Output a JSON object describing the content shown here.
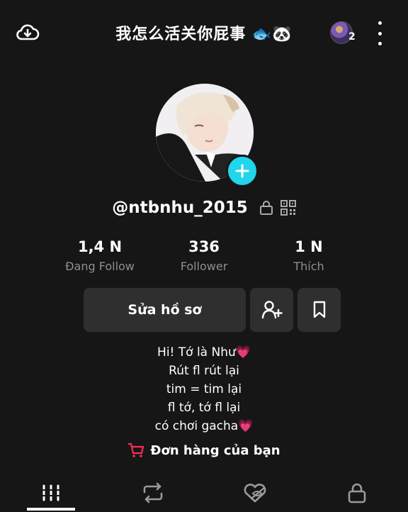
{
  "header": {
    "title": "我怎么活关你屁事 🐟🐼",
    "notification_count": "2"
  },
  "profile": {
    "username": "@ntbnhu_2015"
  },
  "stats": [
    {
      "value": "1,4 N",
      "label": "Đang Follow"
    },
    {
      "value": "336",
      "label": "Follower"
    },
    {
      "value": "1 N",
      "label": "Thích"
    }
  ],
  "actions": {
    "edit_profile": "Sửa hồ sơ"
  },
  "bio": [
    "Hi! Tớ là Như💗",
    "Rút fl rút lại",
    "tim = tim lại",
    "fl  tớ, tớ fl lại",
    "có chơi gacha💗"
  ],
  "orders": {
    "label": "Đơn hàng của bạn"
  },
  "colors": {
    "background": "#161616",
    "accent": "#20d5ec",
    "cart": "#fe2c55"
  }
}
